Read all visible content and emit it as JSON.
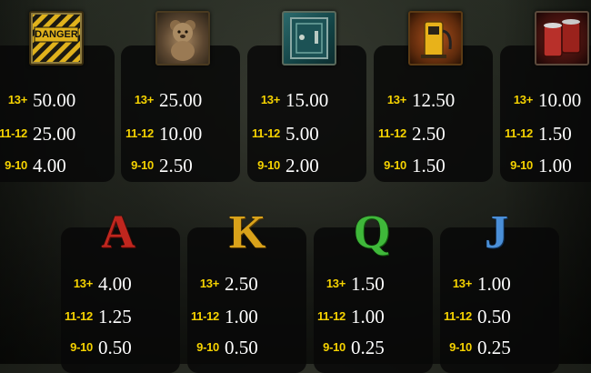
{
  "symbols": [
    {
      "name": "danger",
      "icon": "danger-sign-icon",
      "icon_text": "DANGER",
      "payouts": [
        {
          "range": "13+",
          "value": "50.00"
        },
        {
          "range": "11-12",
          "value": "25.00"
        },
        {
          "range": "9-10",
          "value": "4.00"
        }
      ]
    },
    {
      "name": "teddy-bear",
      "icon": "teddy-bear-icon",
      "payouts": [
        {
          "range": "13+",
          "value": "25.00"
        },
        {
          "range": "11-12",
          "value": "10.00"
        },
        {
          "range": "9-10",
          "value": "2.50"
        }
      ]
    },
    {
      "name": "safe",
      "icon": "safe-box-icon",
      "payouts": [
        {
          "range": "13+",
          "value": "15.00"
        },
        {
          "range": "11-12",
          "value": "5.00"
        },
        {
          "range": "9-10",
          "value": "2.00"
        }
      ]
    },
    {
      "name": "gas-pump",
      "icon": "gas-pump-icon",
      "payouts": [
        {
          "range": "13+",
          "value": "12.50"
        },
        {
          "range": "11-12",
          "value": "2.50"
        },
        {
          "range": "9-10",
          "value": "1.50"
        }
      ]
    },
    {
      "name": "barrels",
      "icon": "barrels-icon",
      "payouts": [
        {
          "range": "13+",
          "value": "10.00"
        },
        {
          "range": "11-12",
          "value": "1.50"
        },
        {
          "range": "9-10",
          "value": "1.00"
        }
      ]
    },
    {
      "name": "letter-a",
      "icon": "letter-a-icon",
      "letter": "A",
      "payouts": [
        {
          "range": "13+",
          "value": "4.00"
        },
        {
          "range": "11-12",
          "value": "1.25"
        },
        {
          "range": "9-10",
          "value": "0.50"
        }
      ]
    },
    {
      "name": "letter-k",
      "icon": "letter-k-icon",
      "letter": "K",
      "payouts": [
        {
          "range": "13+",
          "value": "2.50"
        },
        {
          "range": "11-12",
          "value": "1.00"
        },
        {
          "range": "9-10",
          "value": "0.50"
        }
      ]
    },
    {
      "name": "letter-q",
      "icon": "letter-q-icon",
      "letter": "Q",
      "payouts": [
        {
          "range": "13+",
          "value": "1.50"
        },
        {
          "range": "11-12",
          "value": "1.00"
        },
        {
          "range": "9-10",
          "value": "0.25"
        }
      ]
    },
    {
      "name": "letter-j",
      "icon": "letter-j-icon",
      "letter": "J",
      "payouts": [
        {
          "range": "13+",
          "value": "1.00"
        },
        {
          "range": "11-12",
          "value": "0.50"
        },
        {
          "range": "9-10",
          "value": "0.25"
        }
      ]
    }
  ],
  "colors": {
    "range_text": "#f5d200",
    "value_text": "#ffffff",
    "panel_bg": "#080808",
    "letter_a": "#c0261e",
    "letter_k": "#d9a21a",
    "letter_q": "#3fb83a",
    "letter_j": "#4a8fd8"
  }
}
